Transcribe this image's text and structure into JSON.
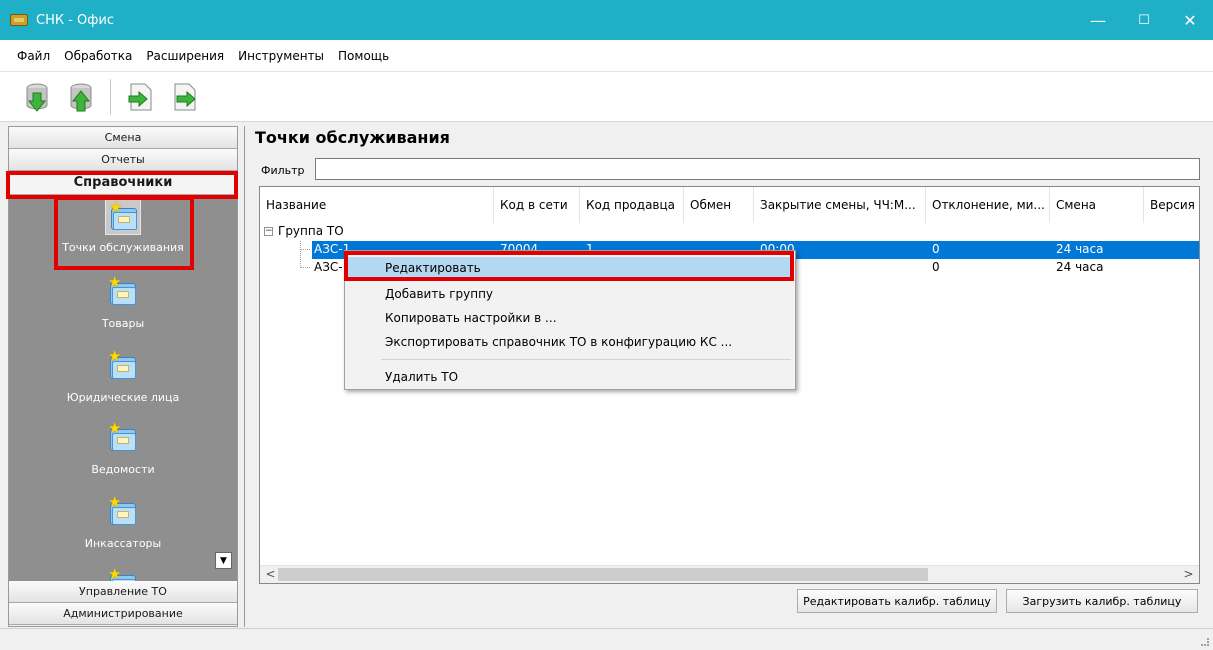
{
  "window": {
    "title": "СНК - Офис",
    "minimize": "—",
    "maximize": "☐",
    "close": "✕"
  },
  "menu": [
    "Файл",
    "Обработка",
    "Расширения",
    "Инструменты",
    "Помощь"
  ],
  "sidebar": {
    "categories_top": [
      "Смена",
      "Отчеты"
    ],
    "active_category": "Справочники",
    "items": [
      {
        "label": "Точки обслуживания"
      },
      {
        "label": "Товары"
      },
      {
        "label": "Юридические лица"
      },
      {
        "label": "Ведомости"
      },
      {
        "label": "Инкассаторы"
      }
    ],
    "categories_bottom": [
      "Управление ТО",
      "Администрирование"
    ]
  },
  "content": {
    "title": "Точки обслуживания",
    "filter_label": "Фильтр",
    "filter_value": "",
    "columns": [
      "Название",
      "Код в сети",
      "Код продавца",
      "Обмен",
      "Закрытие смены, ЧЧ:М...",
      "Отклонение, ми...",
      "Смена",
      "Версия ПО"
    ],
    "group": "Группа ТО",
    "rows": [
      {
        "name": "АЗС-1",
        "network_code": "70004",
        "seller_code": "1",
        "exchange": "",
        "close_time": "00:00",
        "deviation": "0",
        "shift": "24 часа"
      },
      {
        "name": "АЗС-",
        "network_code": "",
        "seller_code": "",
        "exchange": "",
        "close_time": "",
        "deviation": "0",
        "shift": "24 часа"
      }
    ]
  },
  "context_menu": [
    "Редактировать",
    "Добавить группу",
    "Копировать настройки в ...",
    "Экспортировать справочник ТО в конфигурацию КС ...",
    "Удалить ТО"
  ],
  "buttons": {
    "edit_calib": "Редактировать калибр. таблицу",
    "load_calib": "Загрузить калибр. таблицу"
  },
  "scroll": {
    "down": "▼",
    "left": "<",
    "right": ">"
  },
  "colors": {
    "titlebar": "#1fb0c7",
    "selection": "#0078d7",
    "highlight_box": "#e00000",
    "sidebar_bg": "#8f8f8f"
  }
}
